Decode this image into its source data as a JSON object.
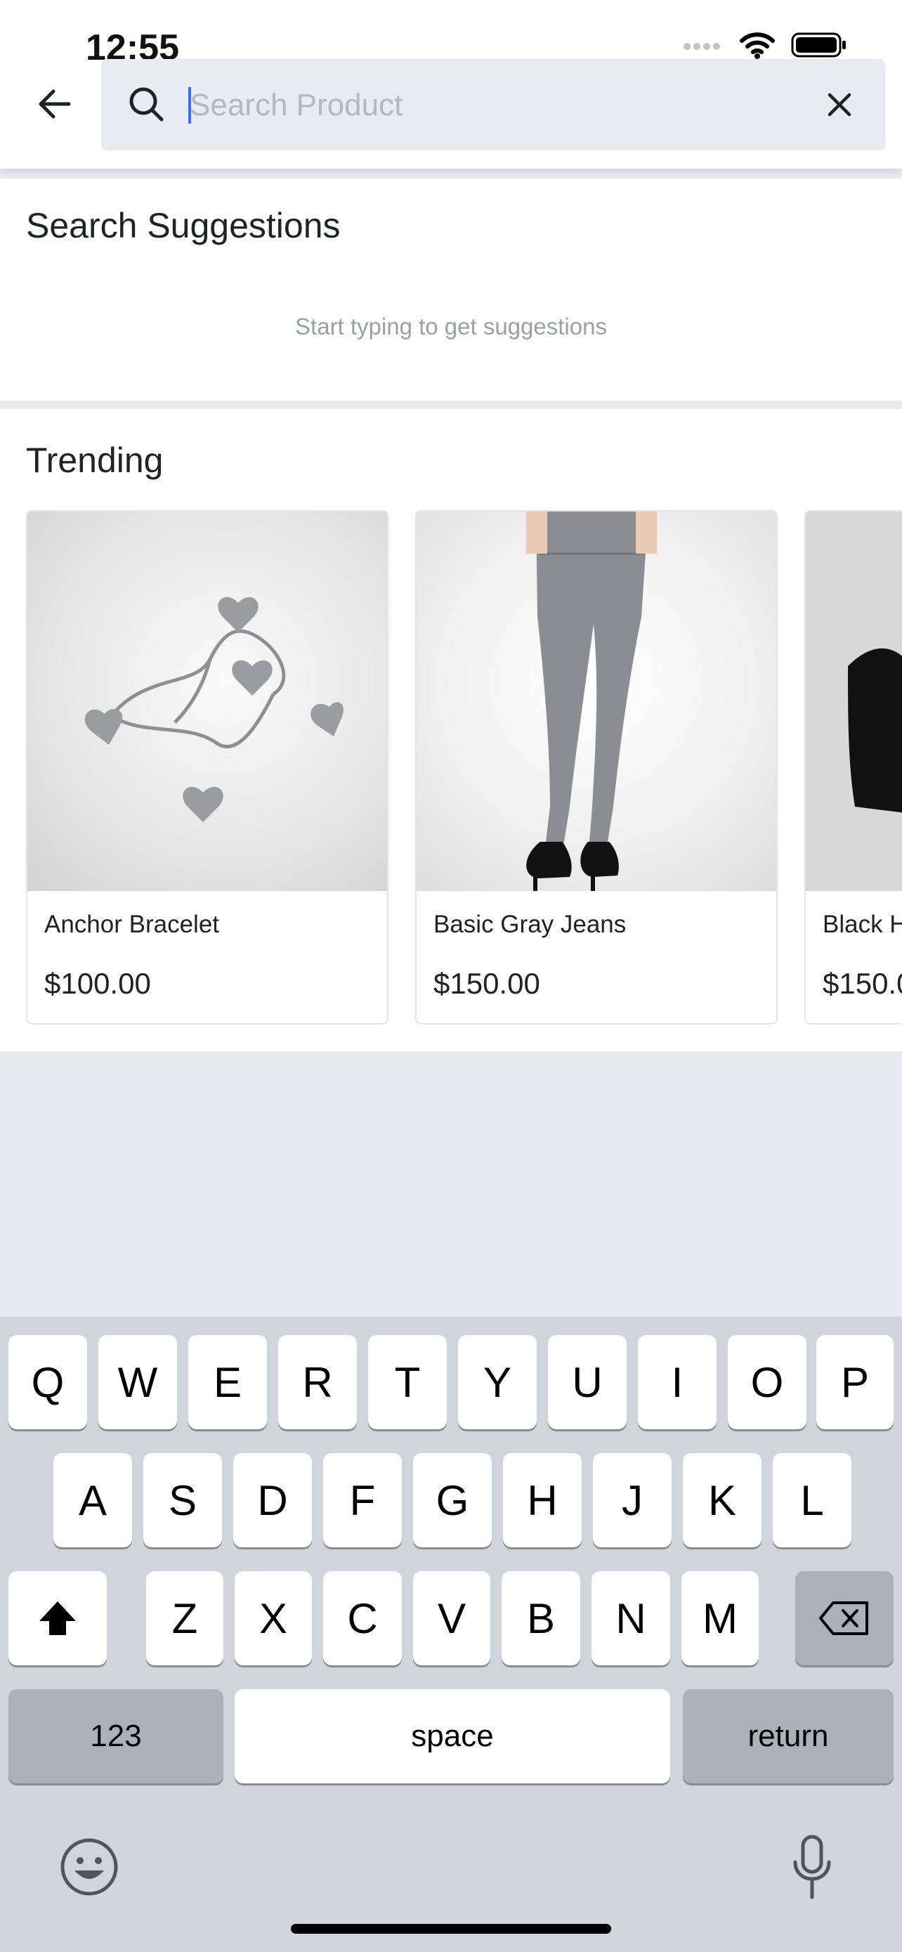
{
  "status_bar": {
    "time": "12:55"
  },
  "search": {
    "placeholder": "Search Product",
    "value": ""
  },
  "suggestions": {
    "title": "Search Suggestions",
    "hint": "Start typing to get suggestions"
  },
  "trending": {
    "title": "Trending",
    "products": [
      {
        "name": "Anchor Bracelet",
        "price": "$100.00"
      },
      {
        "name": "Basic Gray Jeans",
        "price": "$150.00"
      },
      {
        "name": "Black H",
        "price": "$150.0"
      }
    ]
  },
  "keyboard": {
    "row1": [
      "Q",
      "W",
      "E",
      "R",
      "T",
      "Y",
      "U",
      "I",
      "O",
      "P"
    ],
    "row2": [
      "A",
      "S",
      "D",
      "F",
      "G",
      "H",
      "J",
      "K",
      "L"
    ],
    "row3": [
      "Z",
      "X",
      "C",
      "V",
      "B",
      "N",
      "M"
    ],
    "numbers_label": "123",
    "space_label": "space",
    "return_label": "return"
  },
  "colors": {
    "accent": "#3b6df0",
    "page_bg": "#e8eaef",
    "keyboard_bg": "#d1d4db"
  }
}
